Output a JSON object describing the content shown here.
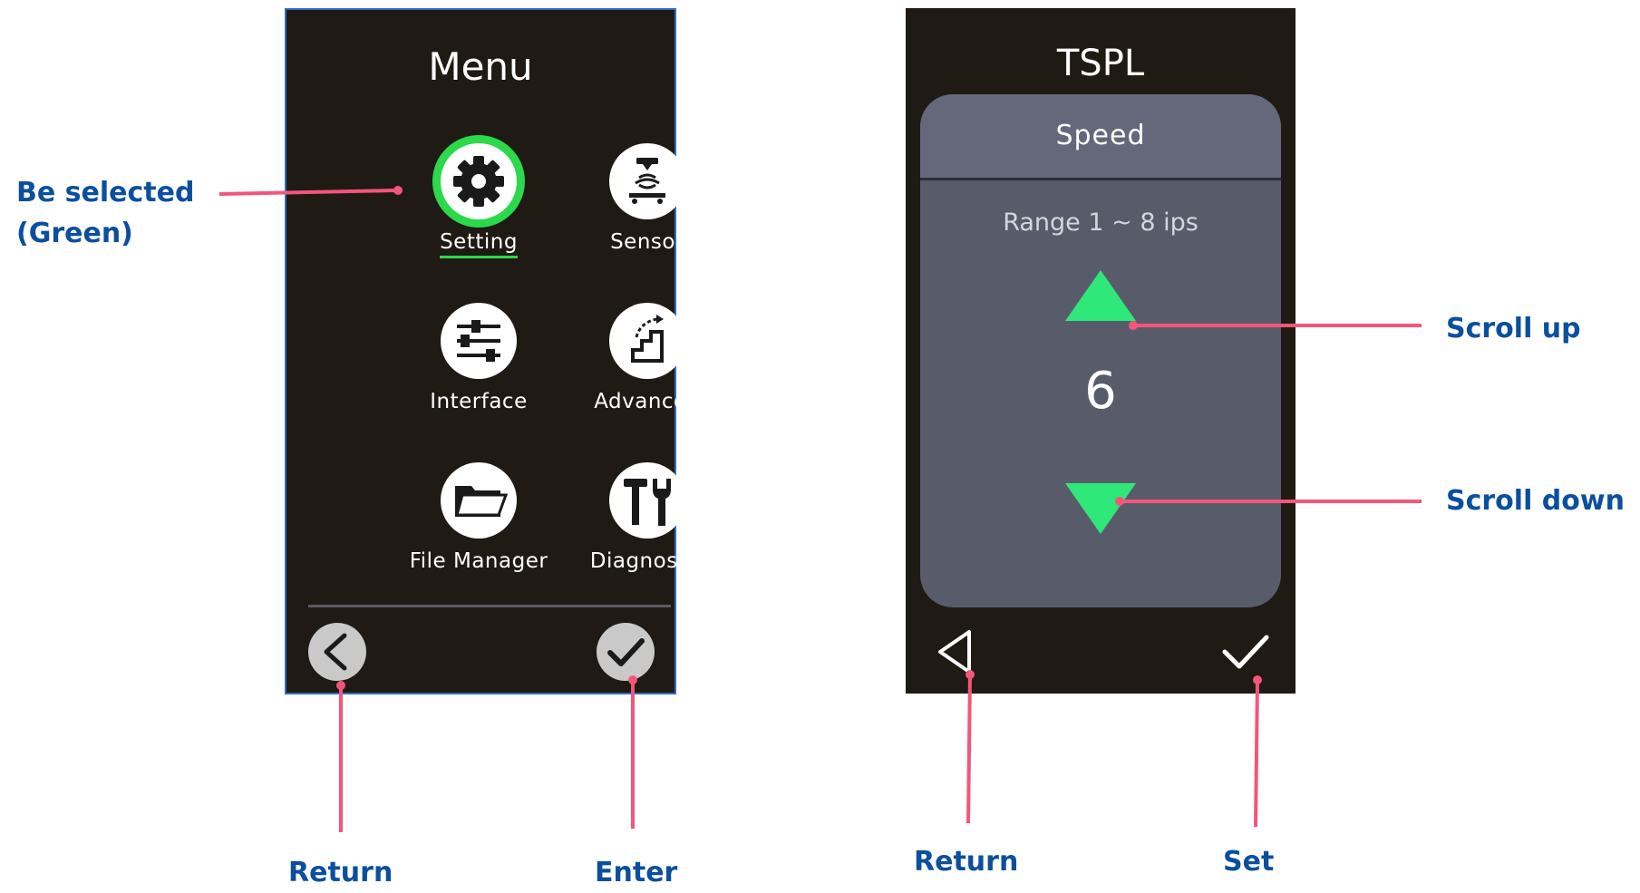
{
  "menu_screen": {
    "title": "Menu",
    "items": [
      {
        "label": "Setting",
        "icon": "gear-icon",
        "selected": true
      },
      {
        "label": "Sensor",
        "icon": "sensor-icon",
        "selected": false
      },
      {
        "label": "Interface",
        "icon": "sliders-icon",
        "selected": false
      },
      {
        "label": "Advanced",
        "icon": "stairs-icon",
        "selected": false
      },
      {
        "label": "File Manager",
        "icon": "folder-icon",
        "selected": false
      },
      {
        "label": "Diagnostic",
        "icon": "tools-icon",
        "selected": false
      }
    ],
    "back_icon": "chevron-left-icon",
    "enter_icon": "check-icon"
  },
  "tspl_screen": {
    "title": "TSPL",
    "panel_title": "Speed",
    "range": "Range 1 ~ 8 ips",
    "value": "6",
    "up_icon": "triangle-up-icon",
    "down_icon": "triangle-down-icon",
    "back_icon": "triangle-left-outline-icon",
    "set_icon": "check-icon"
  },
  "annotations": {
    "be_selected_line1": "Be selected",
    "be_selected_line2": "(Green)",
    "return_left": "Return",
    "enter": "Enter",
    "scroll_up": "Scroll up",
    "scroll_down": "Scroll down",
    "return_right": "Return",
    "set": "Set"
  },
  "colors": {
    "screen_bg": "#201a14",
    "selected_green": "#2bd94a",
    "arrow_green": "#2ee879",
    "panel_gray": "#585c6a",
    "annotation_blue": "#0b4f9e",
    "callout_pink": "#f4557a"
  }
}
